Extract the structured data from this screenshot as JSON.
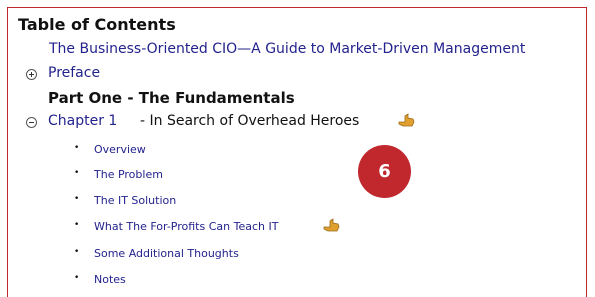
{
  "panel": {
    "title": "Table of Contents",
    "book_title": "The Business-Oriented CIO—A Guide to Market-Driven Management",
    "preface_label": "Preface",
    "part_heading": "Part One - The Fundamentals",
    "chapter": {
      "link_label": "Chapter 1",
      "title": "- In Search of Overhead Heroes",
      "sections": [
        {
          "label": "Overview"
        },
        {
          "label": "The Problem"
        },
        {
          "label": "The IT Solution"
        },
        {
          "label": "What The For-Profits Can Teach IT"
        },
        {
          "label": "Some Additional Thoughts"
        },
        {
          "label": "Notes"
        }
      ]
    }
  },
  "callout": {
    "number": "6",
    "color": "#c0282d"
  },
  "colors": {
    "frame_border": "#c0272d",
    "link": "#23238e",
    "hand_icon": "#e0a030"
  },
  "icons": {
    "expand": "plus-circle-icon",
    "collapse": "minus-circle-icon",
    "pointer": "pointing-hand-icon",
    "bullet": "bullet-icon"
  }
}
